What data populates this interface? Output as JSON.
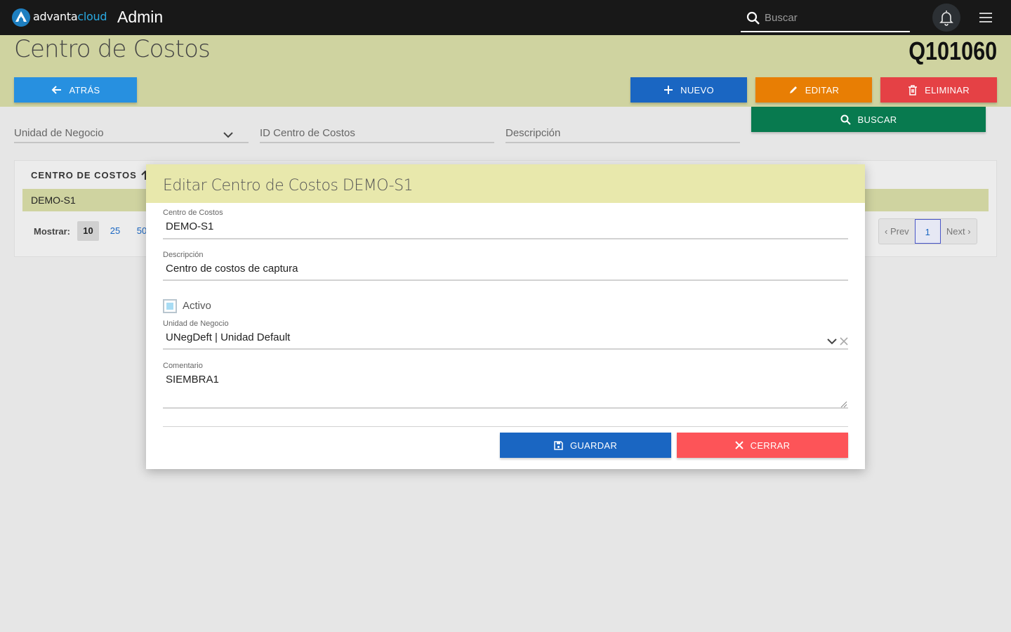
{
  "topbar": {
    "brand_part1": "advanta",
    "brand_part2": "cloud",
    "app_name": "Admin",
    "search_placeholder": "Buscar"
  },
  "header": {
    "title": "Centro de Costos",
    "record_code": "Q101060"
  },
  "actions": {
    "back": "ATRÁS",
    "new": "NUEVO",
    "edit": "EDITAR",
    "delete": "ELIMINAR",
    "search": "BUSCAR"
  },
  "filters": {
    "business_unit": "Unidad de Negocio",
    "cost_center_id": "ID Centro de Costos",
    "description": "Descripción"
  },
  "table": {
    "column_header": "CENTRO DE COSTOS",
    "rows": [
      "DEMO-S1"
    ],
    "show_label": "Mostrar:",
    "page_sizes": [
      "10",
      "25",
      "50"
    ],
    "active_page_size": "10",
    "prev": "‹ Prev",
    "current_page": "1",
    "next": "Next ›"
  },
  "modal": {
    "title": "Editar Centro de Costos DEMO-S1",
    "cost_center_label": "Centro de Costos",
    "cost_center_value": "DEMO-S1",
    "description_label": "Descripción",
    "description_value": "Centro de costos de captura",
    "active_label": "Activo",
    "active_checked": true,
    "business_unit_label": "Unidad de Negocio",
    "business_unit_value": "UNegDeft | Unidad Default",
    "comment_label": "Comentario",
    "comment_value": "SIEMBRA1",
    "save": "GUARDAR",
    "close": "CERRAR"
  },
  "colors": {
    "topbar": "#181818",
    "band": "#cfd3a0",
    "modal_header": "#e8e8ac",
    "primary": "#1a66c2",
    "back": "#2790e0",
    "edit": "#e87e04",
    "delete": "#e54145",
    "search": "#087a4f",
    "close": "#fd5458"
  }
}
